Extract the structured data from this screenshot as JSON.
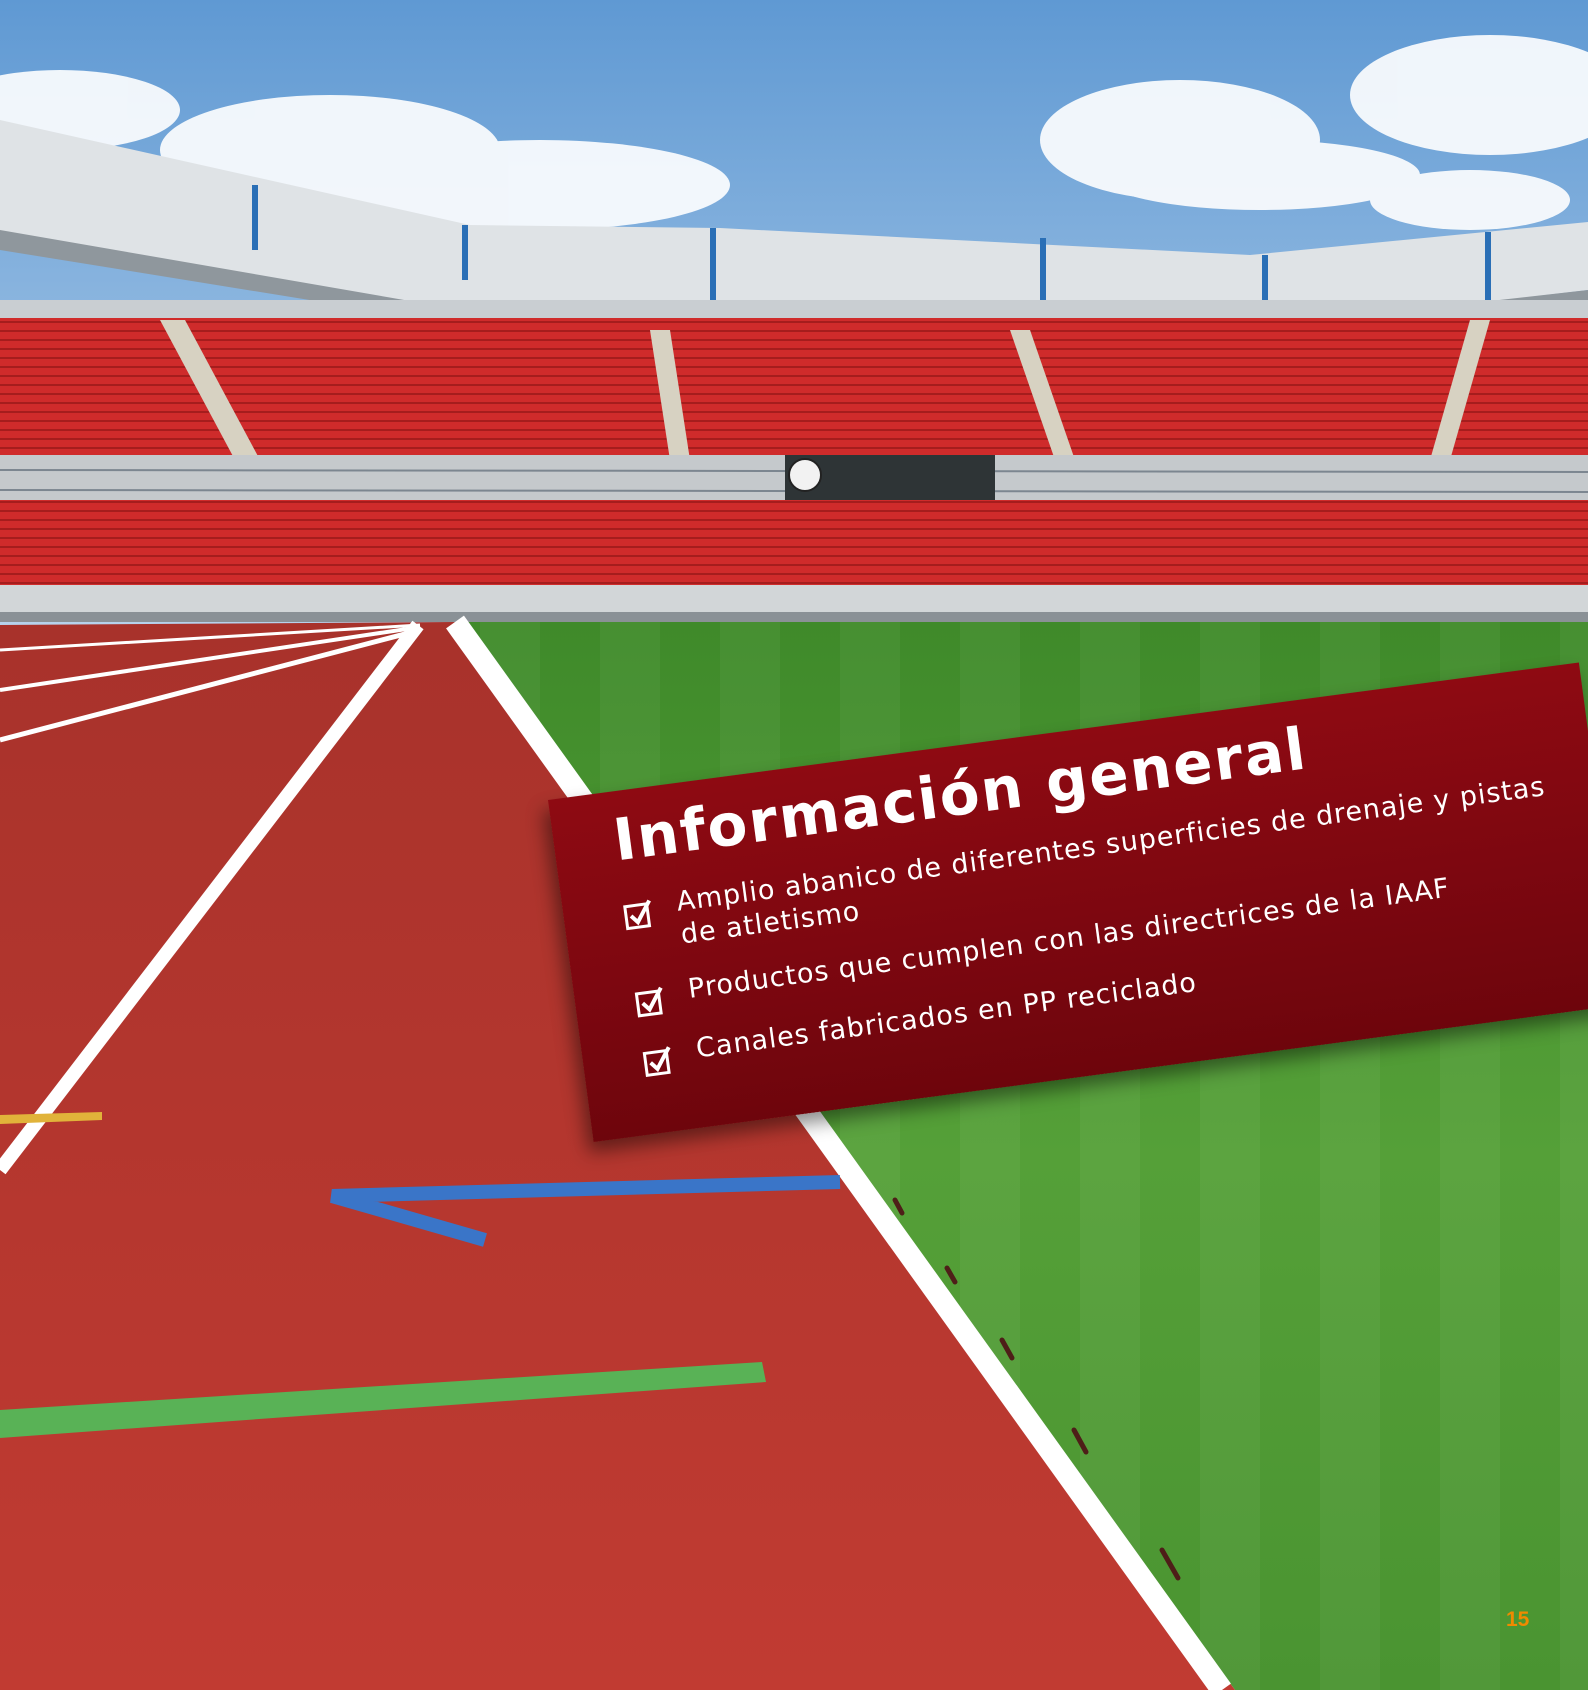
{
  "banner": {
    "title": "Información general",
    "bullets": [
      {
        "text": "Amplio abanico de diferentes superficies de drenaje y pistas de atletismo",
        "icon": "checkbox-checked-icon"
      },
      {
        "text": "Productos que cumplen con las directrices de la IAAF",
        "icon": "checkbox-checked-icon"
      },
      {
        "text": "Canales fabricados en PP reciclado",
        "icon": "checkbox-checked-icon"
      }
    ]
  },
  "page_number": "15",
  "colors": {
    "banner": "#7d0710",
    "page_number": "#f08a00",
    "track": "#b3362e",
    "grass": "#4f9a34",
    "seats": "#cf2b2b",
    "sky": "#7fb2e0"
  }
}
